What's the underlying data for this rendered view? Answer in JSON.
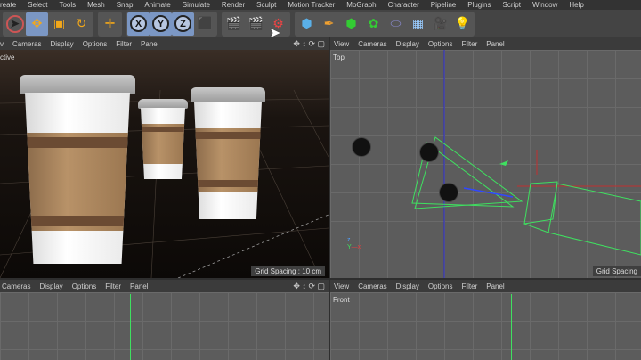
{
  "menu": [
    "reate",
    "Select",
    "Tools",
    "Mesh",
    "Snap",
    "Animate",
    "Simulate",
    "Render",
    "Sculpt",
    "Motion Tracker",
    "MoGraph",
    "Character",
    "Pipeline",
    "Plugins",
    "Script",
    "Window",
    "Help"
  ],
  "toolbar": {
    "axis": [
      "X",
      "Y",
      "Z"
    ]
  },
  "viewports": {
    "top_left": {
      "menu": [
        "v",
        "Cameras",
        "Display",
        "Options",
        "Filter",
        "Panel"
      ],
      "name": "ctive",
      "grid": "Grid Spacing : 10 cm"
    },
    "top_right": {
      "menu": [
        "View",
        "Cameras",
        "Display",
        "Options",
        "Filter",
        "Panel"
      ],
      "name": "Top",
      "grid": "Grid Spacing"
    },
    "bottom_left": {
      "menu": [
        "Cameras",
        "Display",
        "Options",
        "Filter",
        "Panel"
      ]
    },
    "bottom_right": {
      "menu": [
        "View",
        "Cameras",
        "Display",
        "Options",
        "Filter",
        "Panel"
      ],
      "name": "Front"
    }
  },
  "colors": {
    "accent": "#7b97c4",
    "viewport_bg": "#5c5c5c"
  }
}
